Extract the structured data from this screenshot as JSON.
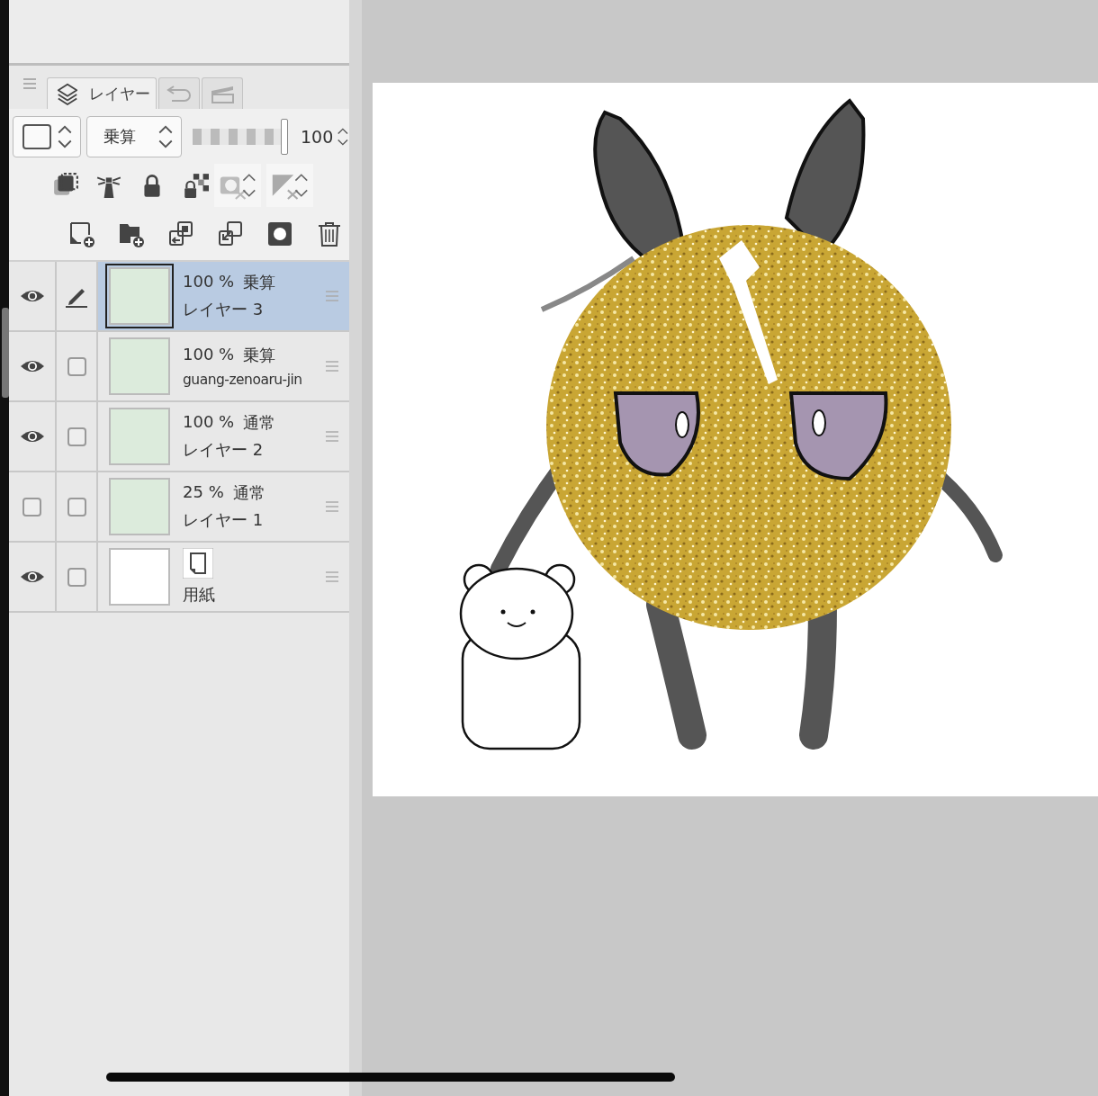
{
  "tabs": [
    {
      "kind": "layers",
      "label": "レイヤー",
      "selected": true
    },
    {
      "kind": "history",
      "selected": false
    },
    {
      "kind": "animation",
      "selected": false
    }
  ],
  "properties": {
    "blend_mode": "乗算",
    "opacity": {
      "level": 1,
      "value": "100"
    }
  },
  "layers": [
    {
      "kind": "raster",
      "visible": true,
      "selected": true,
      "opacity": "100 %",
      "blend": "乗算",
      "name": "レイヤー 3"
    },
    {
      "kind": "raster",
      "visible": true,
      "selected": false,
      "reference": false,
      "opacity": "100 %",
      "blend": "乗算",
      "name": "guang-zenoaru-jin"
    },
    {
      "kind": "raster",
      "visible": true,
      "selected": false,
      "reference": false,
      "opacity": "100 %",
      "blend": "通常",
      "name": "レイヤー 2"
    },
    {
      "kind": "raster",
      "visible": false,
      "selected": false,
      "reference": false,
      "opacity": "25 %",
      "blend": "通常",
      "name": "レイヤー 1"
    },
    {
      "kind": "paper",
      "visible": true,
      "selected": false,
      "reference": false,
      "name": "用紙"
    }
  ]
}
